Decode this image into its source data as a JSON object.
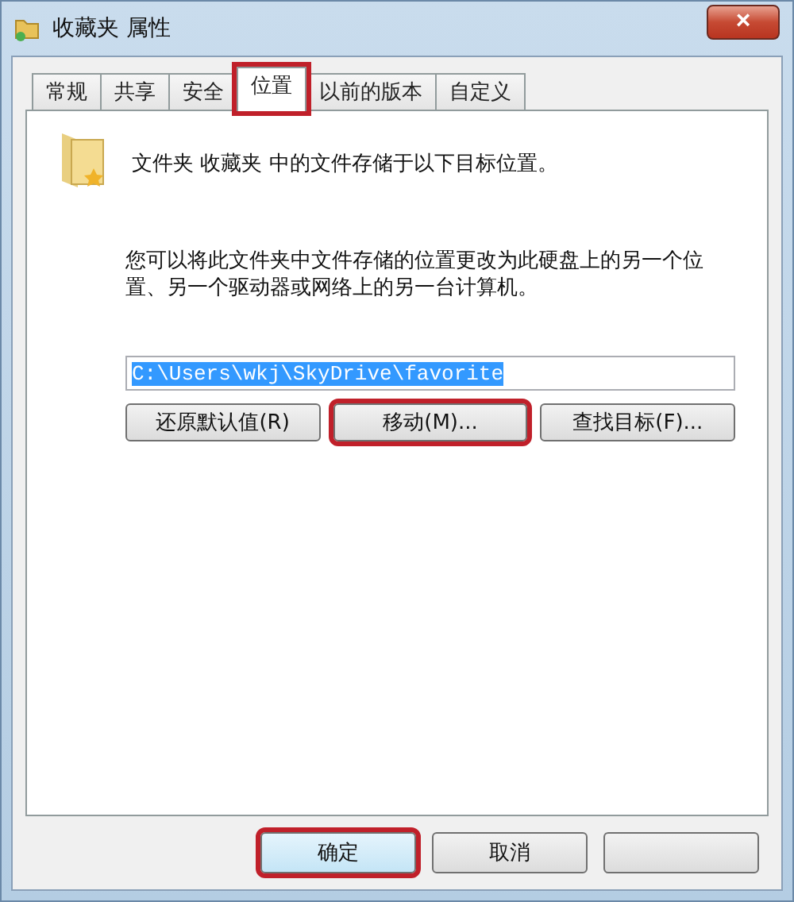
{
  "window": {
    "title": "收藏夹 属性",
    "close_label": "×"
  },
  "tabs": [
    {
      "label": "常规",
      "selected": false,
      "highlighted": false
    },
    {
      "label": "共享",
      "selected": false,
      "highlighted": false
    },
    {
      "label": "安全",
      "selected": false,
      "highlighted": false
    },
    {
      "label": "位置",
      "selected": true,
      "highlighted": true
    },
    {
      "label": "以前的版本",
      "selected": false,
      "highlighted": false
    },
    {
      "label": "自定义",
      "selected": false,
      "highlighted": false
    }
  ],
  "info": "文件夹 收藏夹 中的文件存储于以下目标位置。",
  "description": "您可以将此文件夹中文件存储的位置更改为此硬盘上的另一个位置、另一个驱动器或网络上的另一台计算机。",
  "path_field": {
    "value": "C:\\Users\\wkj\\SkyDrive\\favorite",
    "selected": true
  },
  "location_buttons": [
    {
      "label": "还原默认值(R)",
      "highlighted": false
    },
    {
      "label": "移动(M)...",
      "highlighted": true
    },
    {
      "label": "查找目标(F)...",
      "highlighted": false
    }
  ],
  "dialog_buttons": [
    {
      "label": "确定",
      "highlighted": true
    },
    {
      "label": "取消",
      "highlighted": false
    },
    {
      "highlighted": false
    }
  ]
}
